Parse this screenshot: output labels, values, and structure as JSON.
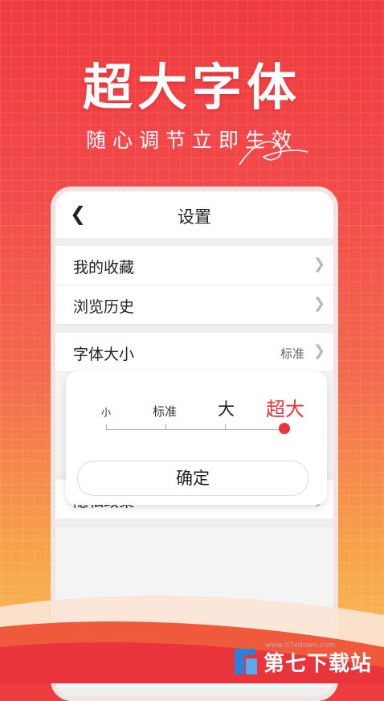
{
  "banner": {
    "headline": "超大字体",
    "subline": "随心调节立即生效"
  },
  "settings": {
    "title": "设置",
    "back_icon": "chevron-left-icon",
    "rows": [
      {
        "label": "我的收藏"
      },
      {
        "label": "浏览历史"
      },
      {
        "label": "字体大小",
        "value": "标准"
      },
      {
        "label": "隐私政策"
      }
    ]
  },
  "font_popup": {
    "levels": [
      "小",
      "标准",
      "大",
      "超大"
    ],
    "selected_level": "超大",
    "selected_index": 3,
    "confirm_label": "确定"
  },
  "watermark": {
    "text": "第七下载站",
    "url": "www.d7xdown.com"
  },
  "colors": {
    "accent": "#e8343a",
    "background_top": "#ef3b3d",
    "background_bottom": "#fbc05a"
  }
}
